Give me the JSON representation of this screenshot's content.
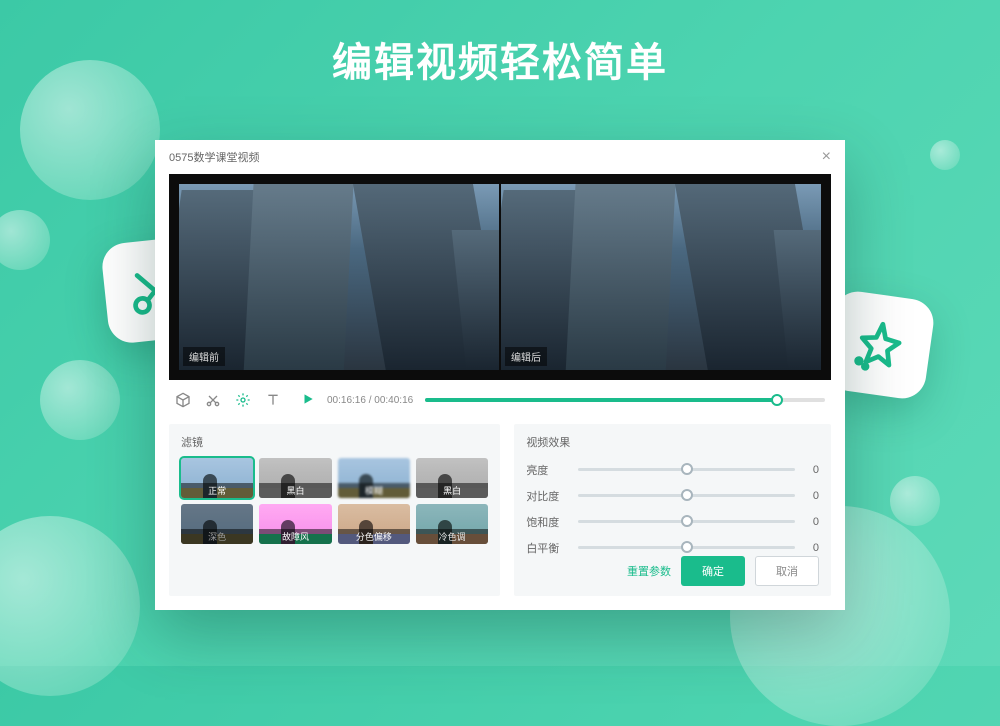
{
  "hero": {
    "title": "编辑视频轻松简单"
  },
  "editor": {
    "file_title": "0575数学课堂视频",
    "preview": {
      "before_label": "编辑前",
      "after_label": "编辑后"
    },
    "playback": {
      "current_time": "00:16:16",
      "total_time": "00:40:16",
      "separator": " / "
    },
    "filters": {
      "panel_title": "滤镜",
      "items": [
        {
          "label": "正常",
          "cls": "",
          "selected": true
        },
        {
          "label": "黑白",
          "cls": "ft-bw"
        },
        {
          "label": "模糊",
          "cls": "ft-blur"
        },
        {
          "label": "黑白",
          "cls": "ft-bw"
        },
        {
          "label": "深色",
          "cls": "ft-dark"
        },
        {
          "label": "故障风",
          "cls": "ft-glitch"
        },
        {
          "label": "分色偏移",
          "cls": "ft-split"
        },
        {
          "label": "冷色调",
          "cls": "ft-cold"
        }
      ]
    },
    "effects": {
      "panel_title": "视频效果",
      "sliders": [
        {
          "label": "亮度",
          "value": 0
        },
        {
          "label": "对比度",
          "value": 0
        },
        {
          "label": "饱和度",
          "value": 0
        },
        {
          "label": "白平衡",
          "value": 0
        }
      ]
    },
    "actions": {
      "reset": "重置参数",
      "confirm": "确定",
      "cancel": "取消"
    }
  }
}
